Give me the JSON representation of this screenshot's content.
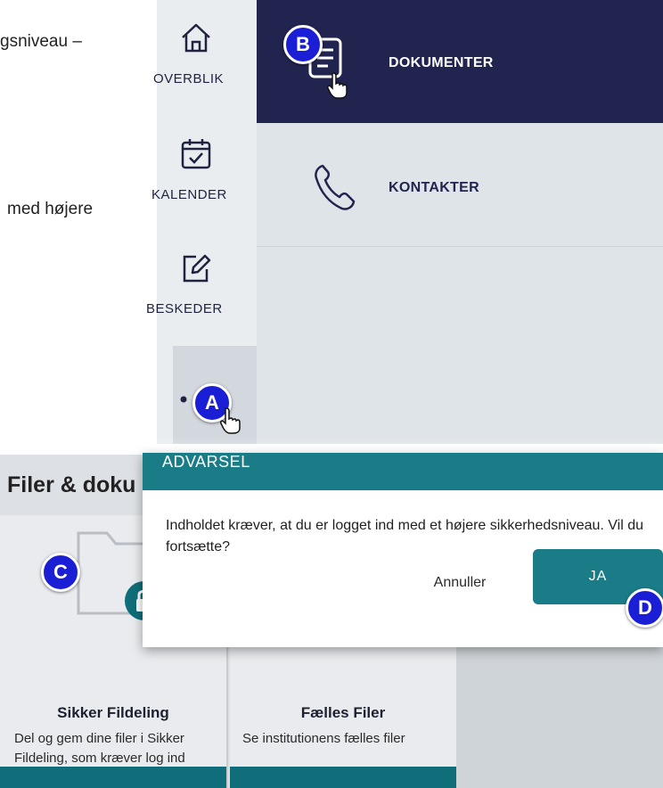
{
  "background_text": {
    "line1": "gsniveau –",
    "line2": "med højere"
  },
  "nav": {
    "rail": [
      {
        "label": "OVERBLIK",
        "icon": "home-icon"
      },
      {
        "label": "KALENDER",
        "icon": "calendar-icon"
      },
      {
        "label": "BESKEDER",
        "icon": "edit-icon"
      },
      {
        "label": "",
        "icon": "more-icon"
      }
    ],
    "menu": [
      {
        "label": "DOKUMENTER",
        "icon": "document-icon",
        "active": true
      },
      {
        "label": "KONTAKTER",
        "icon": "phone-icon",
        "active": false
      }
    ],
    "active_color": "#222450"
  },
  "callouts": {
    "a": "A",
    "b": "B",
    "c": "C",
    "d": "D",
    "color": "#1a1fd6"
  },
  "files": {
    "title": "Filer & doku",
    "cards": [
      {
        "title": "Sikker Fildeling",
        "description": "Del og gem dine filer i Sikker Fildeling, som kræver log ind",
        "icon": "locked-folder-icon"
      },
      {
        "title": "Fælles Filer",
        "description": "Se institutionens fælles filer"
      }
    ]
  },
  "dialog": {
    "title": "ADVARSEL",
    "message": "Indholdet kræver, at du er logget ind med et højere sikkerhedsniveau. Vil du fortsætte?",
    "cancel_label": "Annuller",
    "confirm_label": "JA",
    "accent": "#1a7c86"
  }
}
